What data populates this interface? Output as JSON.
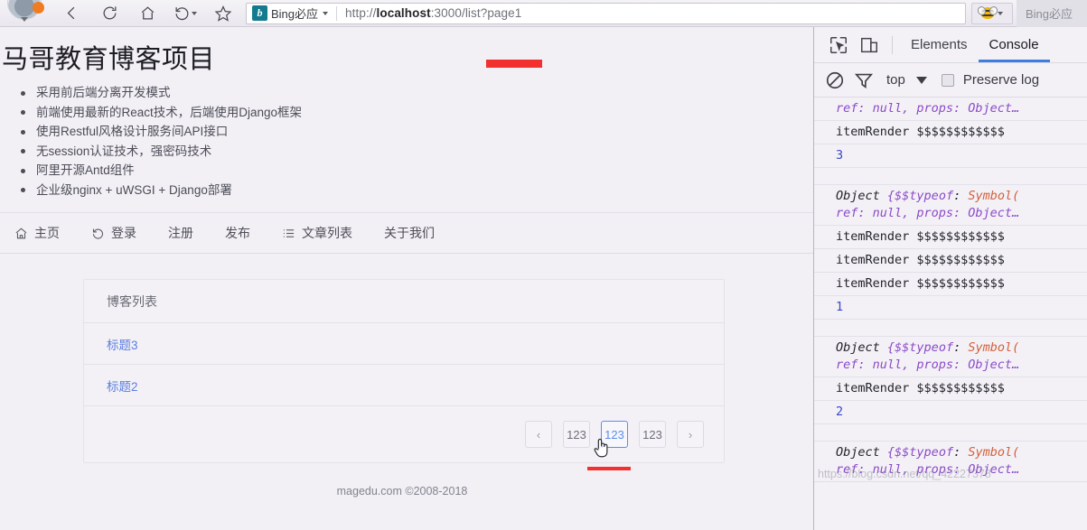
{
  "browser": {
    "back_icon": "back-arrow-icon",
    "reload_icon": "reload-icon",
    "home_icon": "home-icon",
    "history_icon": "history-back-icon",
    "bookmark_icon": "star-icon",
    "search_engine": "Bing必应",
    "url_prefix": "http://",
    "url_host": "localhost",
    "url_rest": ":3000/list?page1",
    "extension_icon": "bee-extension-icon",
    "right_tab_label": "Bing必应"
  },
  "page": {
    "title": "马哥教育博客项目",
    "bullets": [
      "采用前后端分离开发模式",
      "前端使用最新的React技术，后端使用Django框架",
      "使用Restful风格设计服务间API接口",
      "无session认证技术，强密码技术",
      "阿里开源Antd组件",
      "企业级nginx + uWSGI + Django部署"
    ],
    "nav": [
      {
        "label": "主页",
        "icon": "home-icon"
      },
      {
        "label": "登录",
        "icon": "login-icon"
      },
      {
        "label": "注册",
        "icon": ""
      },
      {
        "label": "发布",
        "icon": ""
      },
      {
        "label": "文章列表",
        "icon": "list-icon"
      },
      {
        "label": "关于我们",
        "icon": ""
      }
    ],
    "card": {
      "header": "博客列表",
      "rows": [
        "标题3",
        "标题2"
      ]
    },
    "pagination": {
      "prev": "‹",
      "next": "›",
      "items": [
        "123",
        "123",
        "123"
      ],
      "active_index": 1
    },
    "footer": "magedu.com ©2008-2018"
  },
  "devtools": {
    "inspect_icon": "inspect-element-icon",
    "device_icon": "device-toolbar-icon",
    "tabs": [
      {
        "label": "Elements",
        "active": false
      },
      {
        "label": "Console",
        "active": true
      }
    ],
    "toolbar": {
      "clear_icon": "clear-console-icon",
      "filter_icon": "filter-funnel-icon",
      "context": "top",
      "preserve_log": "Preserve log"
    },
    "console_rows": [
      {
        "type": "object-cont",
        "text": "ref: null, props: Object…"
      },
      {
        "type": "log",
        "text": "itemRender $$$$$$$$$$$$"
      },
      {
        "type": "num",
        "text": "3"
      },
      {
        "type": "blank",
        "text": ""
      },
      {
        "type": "object",
        "head": "Object ",
        "brace": "{",
        "prop": "$$typeof",
        "colon": ": ",
        "sym": "Symbol(",
        "cont": "ref: null, props: Object…"
      },
      {
        "type": "log",
        "text": "itemRender $$$$$$$$$$$$"
      },
      {
        "type": "log",
        "text": "itemRender $$$$$$$$$$$$"
      },
      {
        "type": "log",
        "text": "itemRender $$$$$$$$$$$$"
      },
      {
        "type": "num",
        "text": "1"
      },
      {
        "type": "blank",
        "text": ""
      },
      {
        "type": "object",
        "head": "Object ",
        "brace": "{",
        "prop": "$$typeof",
        "colon": ": ",
        "sym": "Symbol(",
        "cont": "ref: null, props: Object…"
      },
      {
        "type": "log",
        "text": "itemRender $$$$$$$$$$$$"
      },
      {
        "type": "num",
        "text": "2"
      },
      {
        "type": "blank",
        "text": ""
      },
      {
        "type": "object",
        "head": "Object ",
        "brace": "{",
        "prop": "$$typeof",
        "colon": ": ",
        "sym": "Symbol(",
        "cont": "ref: null, props: Object…"
      }
    ],
    "watermark": "https://blog.csdn.net/qq_42227378"
  }
}
